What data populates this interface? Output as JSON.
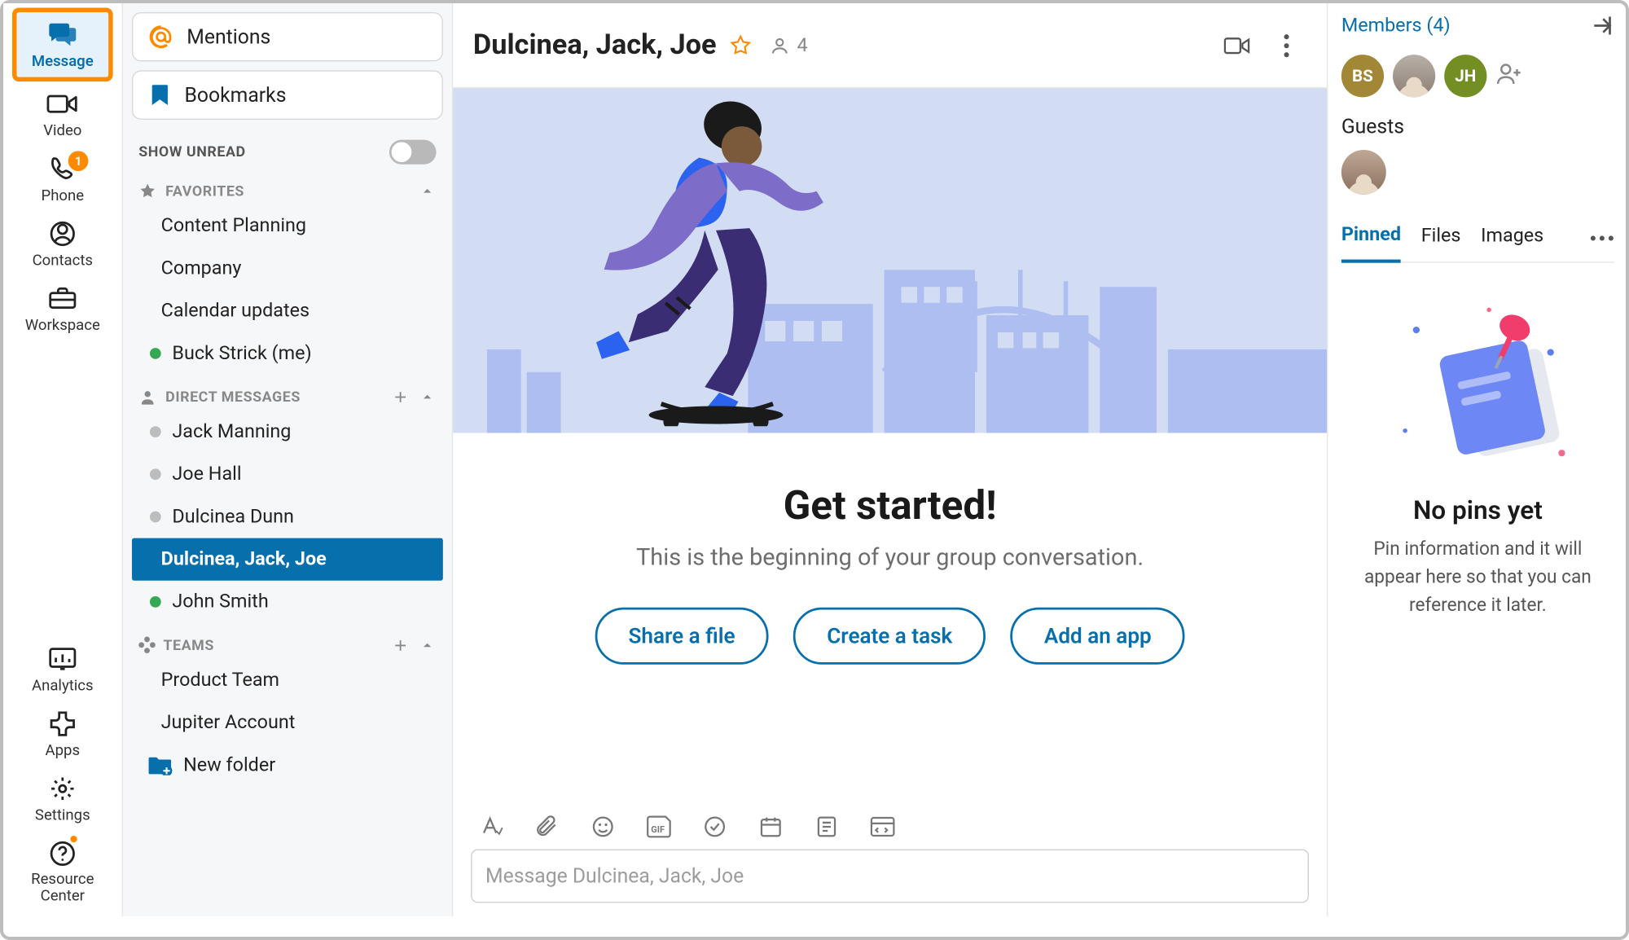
{
  "nav_rail": {
    "items": [
      {
        "label": "Message",
        "icon": "message-icon",
        "active": true
      },
      {
        "label": "Video",
        "icon": "video-icon"
      },
      {
        "label": "Phone",
        "icon": "phone-icon",
        "badge": "1"
      },
      {
        "label": "Contacts",
        "icon": "contacts-icon"
      },
      {
        "label": "Workspace",
        "icon": "workspace-icon"
      }
    ],
    "bottom_items": [
      {
        "label": "Analytics",
        "icon": "analytics-icon"
      },
      {
        "label": "Apps",
        "icon": "apps-icon"
      },
      {
        "label": "Settings",
        "icon": "settings-icon"
      },
      {
        "label": "Resource Center",
        "icon": "resource-center-icon",
        "dot": true
      }
    ]
  },
  "convo_col": {
    "mentions_label": "Mentions",
    "bookmarks_label": "Bookmarks",
    "show_unread_label": "SHOW UNREAD",
    "show_unread_on": false,
    "favorites_label": "FAVORITES",
    "favorites": [
      {
        "label": "Content Planning"
      },
      {
        "label": "Company"
      },
      {
        "label": "Calendar updates"
      },
      {
        "label": "Buck Strick (me)",
        "presence": "green"
      }
    ],
    "dm_label": "DIRECT MESSAGES",
    "dms": [
      {
        "label": "Jack Manning",
        "presence": "grey"
      },
      {
        "label": "Joe Hall",
        "presence": "grey"
      },
      {
        "label": "Dulcinea Dunn",
        "presence": "grey"
      },
      {
        "label": "Dulcinea, Jack, Joe",
        "selected": true
      },
      {
        "label": "John Smith",
        "presence": "green"
      }
    ],
    "teams_label": "TEAMS",
    "teams": [
      {
        "label": "Product Team"
      },
      {
        "label": "Jupiter Account"
      }
    ],
    "new_folder_label": "New folder"
  },
  "chat": {
    "title": "Dulcinea, Jack, Joe",
    "member_count": "4",
    "welcome_title": "Get started!",
    "welcome_sub": "This is the beginning of your group conversation.",
    "cta": [
      "Share a file",
      "Create a task",
      "Add an app"
    ],
    "composer_placeholder": "Message Dulcinea, Jack, Joe"
  },
  "right": {
    "members_link": "Members (4)",
    "avatars": [
      {
        "initials": "BS",
        "cls": "bs"
      },
      {
        "photo": true
      },
      {
        "initials": "JH",
        "cls": "jh"
      }
    ],
    "guests_label": "Guests",
    "tabs": [
      "Pinned",
      "Files",
      "Images"
    ],
    "active_tab": "Pinned",
    "empty_title": "No pins yet",
    "empty_sub": "Pin information and it will appear here so that you can reference it later."
  }
}
